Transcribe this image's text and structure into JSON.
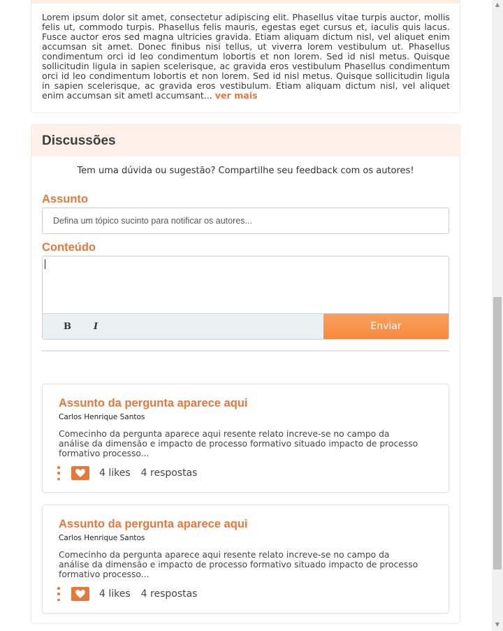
{
  "description": {
    "text": "Lorem ipsum dolor sit amet, consectetur adipiscing elit. Phasellus vitae turpis auctor, mollis felis ut, commodo turpis. Phasellus felis mauris, egestas eget cursus et, iaculis quis lacus. Fusce auctor eros sed magna ultricies gravida. Etiam aliquam dictum nisl, vel aliquet enim accumsan sit amet. Donec finibus nisi tellus, ut viverra lorem vestibulum ut. Phasellus condimentum orci id leo condimentum lobortis et non lorem. Sed id nisl metus. Quisque sollicitudin ligula in sapien scelerisque, ac gravida eros vestibulum Phasellus condimentum orci id leo condimentum lobortis et non lorem. Sed id nisl metus. Quisque sollicitudin ligula in sapien scelerisque, ac gravida eros vestibulum. Etiam aliquam dictum nisl, vel aliquet enim accumsan sit ametl accumsant...",
    "more_label": "ver mais"
  },
  "discussions": {
    "title": "Discussões",
    "intro": "Tem uma dúvida ou sugestão? Compartilhe seu feedback com os autores!",
    "subject_label": "Assunto",
    "subject_placeholder": "Defina um tópico sucinto para notificar os autores...",
    "subject_value": "",
    "content_label": "Conteúdo",
    "content_value": "",
    "bold_label": "B",
    "italic_label": "I",
    "send_label": "Enviar"
  },
  "questions": [
    {
      "title": "Assunto da pergunta aparece aqui",
      "author": "Carlos Henrique Santos",
      "excerpt": "Comecinho da pergunta aparece aqui resente relato increve-se no campo da análise da dimensão e impacto de processo formativo situado impacto de processo formativo processo...",
      "likes": "4 likes",
      "answers": "4 respostas"
    },
    {
      "title": "Assunto da pergunta aparece aqui",
      "author": "Carlos Henrique Santos",
      "excerpt": "Comecinho da pergunta aparece aqui resente relato increve-se no campo da análise da dimensão e impacto de processo formativo situado impacto de processo formativo processo...",
      "likes": "4 likes",
      "answers": "4 respostas"
    }
  ],
  "colors": {
    "accent": "#e8773a",
    "header_bg": "#fdf1ea",
    "send_button": "#f58a3e",
    "toolbar_bg": "#ebf0f2"
  },
  "icons": [
    "kebab-menu-icon",
    "heart-icon",
    "bold-icon",
    "italic-icon"
  ]
}
